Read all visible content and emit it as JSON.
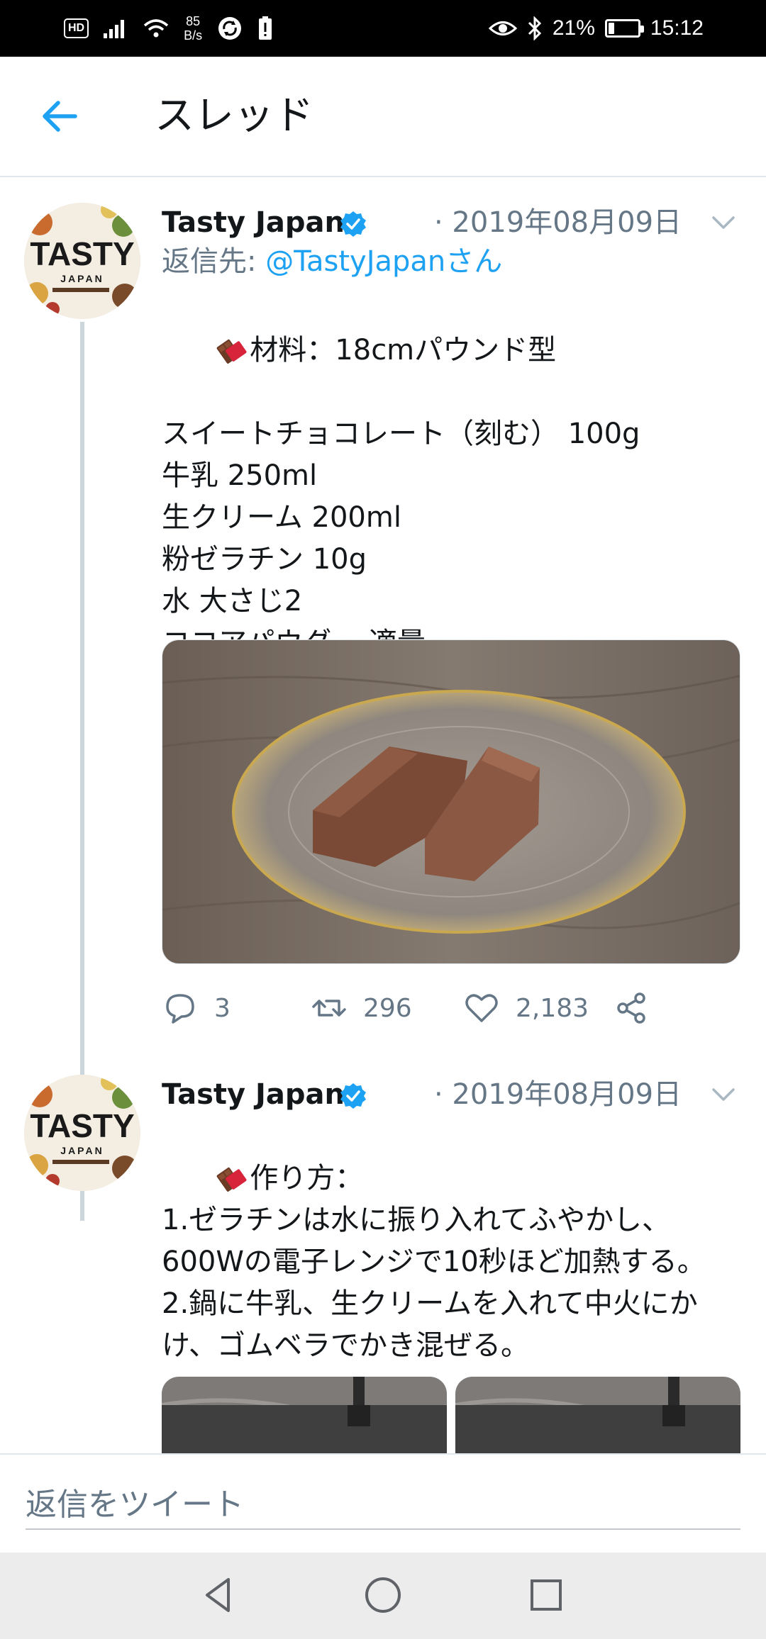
{
  "status_bar": {
    "hd_badge": "HD",
    "speed_value": "85",
    "speed_unit": "B/s",
    "battery_percent": "21%",
    "battery_level": 0.21,
    "time": "15:12"
  },
  "header": {
    "title": "スレッド"
  },
  "tweets": [
    {
      "author_name": "Tasty Japan",
      "date": "· 2019年08月09日",
      "reply_prefix": "返信先: ",
      "reply_handle": "@TastyJapanさん",
      "text": "材料：18cmパウンド型\n\nスイートチョコレート（刻む） 100g\n牛乳 250ml\n生クリーム 200ml\n粉ゼラチン 10g\n水 大さじ2\nココアパウダー 適量",
      "reply_count": "3",
      "retweet_count": "296",
      "like_count": "2,183"
    },
    {
      "author_name": "Tasty Japan",
      "date": "· 2019年08月09日",
      "text": "作り方：\n1.ゼラチンは水に振り入れてふやかし、600Wの電子レンジで10秒ほど加熱する。\n2.鍋に牛乳、生クリームを入れて中火にかけ、ゴムベラでかき混ぜる。"
    }
  ],
  "avatar_logo": {
    "line1": "TASTY",
    "line2": "JAPAN"
  },
  "reply_bar": {
    "placeholder": "返信をツイート"
  },
  "colors": {
    "accent": "#1da1f2",
    "secondary_text": "#657786",
    "divider": "#e1e8ed"
  }
}
